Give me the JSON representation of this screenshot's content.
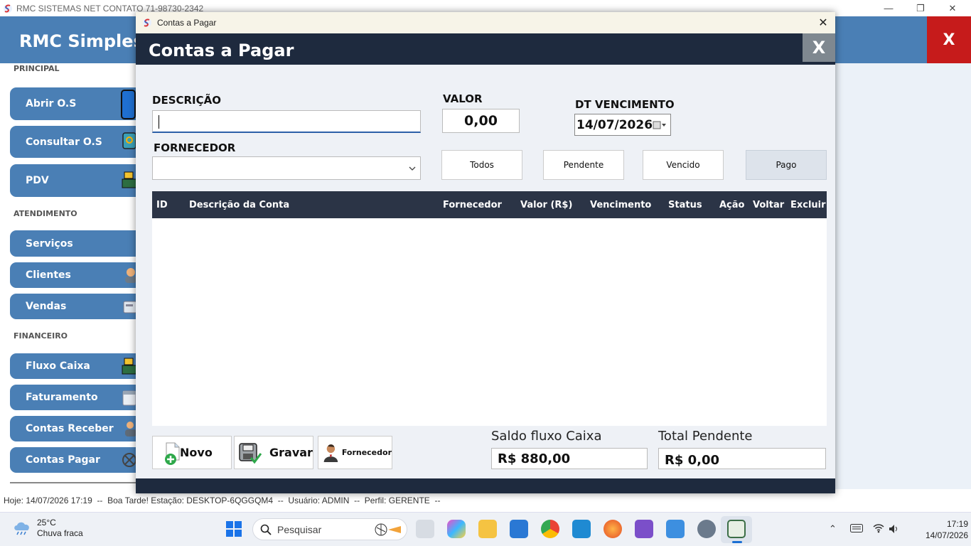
{
  "outer_window": {
    "title": "RMC SISTEMAS NET CONTATO 71-98730-2342",
    "minimize": "—",
    "restore": "❐",
    "close": "✕"
  },
  "app": {
    "brand": "RMC Simples",
    "close": "X"
  },
  "sidebar": {
    "sections": [
      "PRINCIPAL",
      "ATENDIMENTO",
      "FINANCEIRO"
    ],
    "items": [
      {
        "label": "Abrir O.S",
        "icon": "phone-icon"
      },
      {
        "label": "Consultar O.S",
        "icon": "device-search-icon"
      },
      {
        "label": "PDV",
        "icon": "cash-register-icon"
      },
      {
        "label": "Serviços",
        "icon": ""
      },
      {
        "label": "Clientes",
        "icon": "clients-icon"
      },
      {
        "label": "Vendas",
        "icon": "sales-icon"
      },
      {
        "label": "Fluxo Caixa",
        "icon": "cash-flow-icon"
      },
      {
        "label": "Faturamento",
        "icon": "calendar-icon"
      },
      {
        "label": "Contas Receber",
        "icon": "receivable-icon"
      },
      {
        "label": "Contas Pagar",
        "icon": "payable-icon"
      }
    ]
  },
  "status_bar": {
    "text": "Hoje: 14/07/2026 17:19  --  Boa Tarde! Estação: DESKTOP-6QGGQM4  --  Usuário: ADMIN  --  Perfil: GERENTE  --"
  },
  "dialog": {
    "window_title": "Contas a Pagar",
    "heading": "Contas a Pagar",
    "close": "X",
    "titlebar_close": "✕",
    "form": {
      "descricao_label": "DESCRIÇÃO",
      "descricao_value": "",
      "valor_label": "VALOR",
      "valor_value": "0,00",
      "vencimento_label": "DT VENCIMENTO",
      "vencimento_value": "14/07/2026",
      "fornecedor_label": "FORNECEDOR",
      "fornecedor_value": ""
    },
    "filters": [
      {
        "label": "Todos",
        "active": false
      },
      {
        "label": "Pendente",
        "active": false
      },
      {
        "label": "Vencido",
        "active": false
      },
      {
        "label": "Pago",
        "active": true
      }
    ],
    "table": {
      "columns": [
        "ID",
        "Descrição da Conta",
        "Fornecedor",
        "Valor (R$)",
        "Vencimento",
        "Status",
        "Ação",
        "Voltar",
        "Excluir"
      ],
      "rows": []
    },
    "actions": {
      "novo": "Novo",
      "gravar": "Gravar",
      "fornecedor": "Fornecedor"
    },
    "summary": {
      "saldo_label": "Saldo fluxo Caixa",
      "saldo_value": "R$ 880,00",
      "pendente_label": "Total Pendente",
      "pendente_value": "R$ 0,00"
    }
  },
  "taskbar": {
    "weather_temp": "25°C",
    "weather_desc": "Chuva fraca",
    "search_placeholder": "Pesquisar",
    "time": "17:19",
    "date": "14/07/2026"
  },
  "colors": {
    "app_blue": "#4a7fb5",
    "app_close_red": "#c61b1b",
    "dialog_header": "#1e2a3e",
    "table_header": "#2b3446"
  }
}
